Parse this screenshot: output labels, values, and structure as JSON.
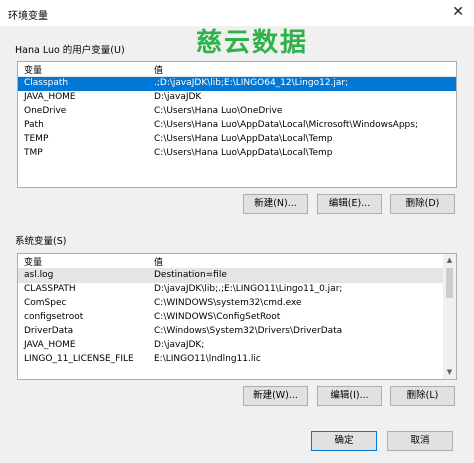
{
  "window": {
    "title": "环境变量",
    "close_glyph": "✕"
  },
  "watermark": "慈云数据",
  "user_section": {
    "label": "Hana Luo 的用户变量(U)",
    "columns": [
      "变量",
      "值"
    ],
    "rows": [
      {
        "name": "Classpath",
        "value": ".;D:\\javaJDK\\lib;E:\\LINGO64_12\\Lingo12.jar;"
      },
      {
        "name": "JAVA_HOME",
        "value": "D:\\javaJDK"
      },
      {
        "name": "OneDrive",
        "value": "C:\\Users\\Hana Luo\\OneDrive"
      },
      {
        "name": "Path",
        "value": "C:\\Users\\Hana Luo\\AppData\\Local\\Microsoft\\WindowsApps;"
      },
      {
        "name": "TEMP",
        "value": "C:\\Users\\Hana Luo\\AppData\\Local\\Temp"
      },
      {
        "name": "TMP",
        "value": "C:\\Users\\Hana Luo\\AppData\\Local\\Temp"
      }
    ],
    "buttons": {
      "new": "新建(N)...",
      "edit": "编辑(E)...",
      "delete": "删除(D)"
    }
  },
  "system_section": {
    "label": "系统变量(S)",
    "columns": [
      "变量",
      "值"
    ],
    "rows": [
      {
        "name": "asl.log",
        "value": "Destination=file"
      },
      {
        "name": "CLASSPATH",
        "value": "D:\\javaJDK\\lib;.;E:\\LINGO11\\Lingo11_0.jar;"
      },
      {
        "name": "ComSpec",
        "value": "C:\\WINDOWS\\system32\\cmd.exe"
      },
      {
        "name": "configsetroot",
        "value": "C:\\WINDOWS\\ConfigSetRoot"
      },
      {
        "name": "DriverData",
        "value": "C:\\Windows\\System32\\Drivers\\DriverData"
      },
      {
        "name": "JAVA_HOME",
        "value": "D:\\javaJDK;"
      },
      {
        "name": "LINGO_11_LICENSE_FILE",
        "value": "E:\\LINGO11\\lndlng11.lic"
      }
    ],
    "buttons": {
      "new": "新建(W)...",
      "edit": "编辑(I)...",
      "delete": "删除(L)"
    }
  },
  "footer": {
    "ok": "确定",
    "cancel": "取消"
  }
}
